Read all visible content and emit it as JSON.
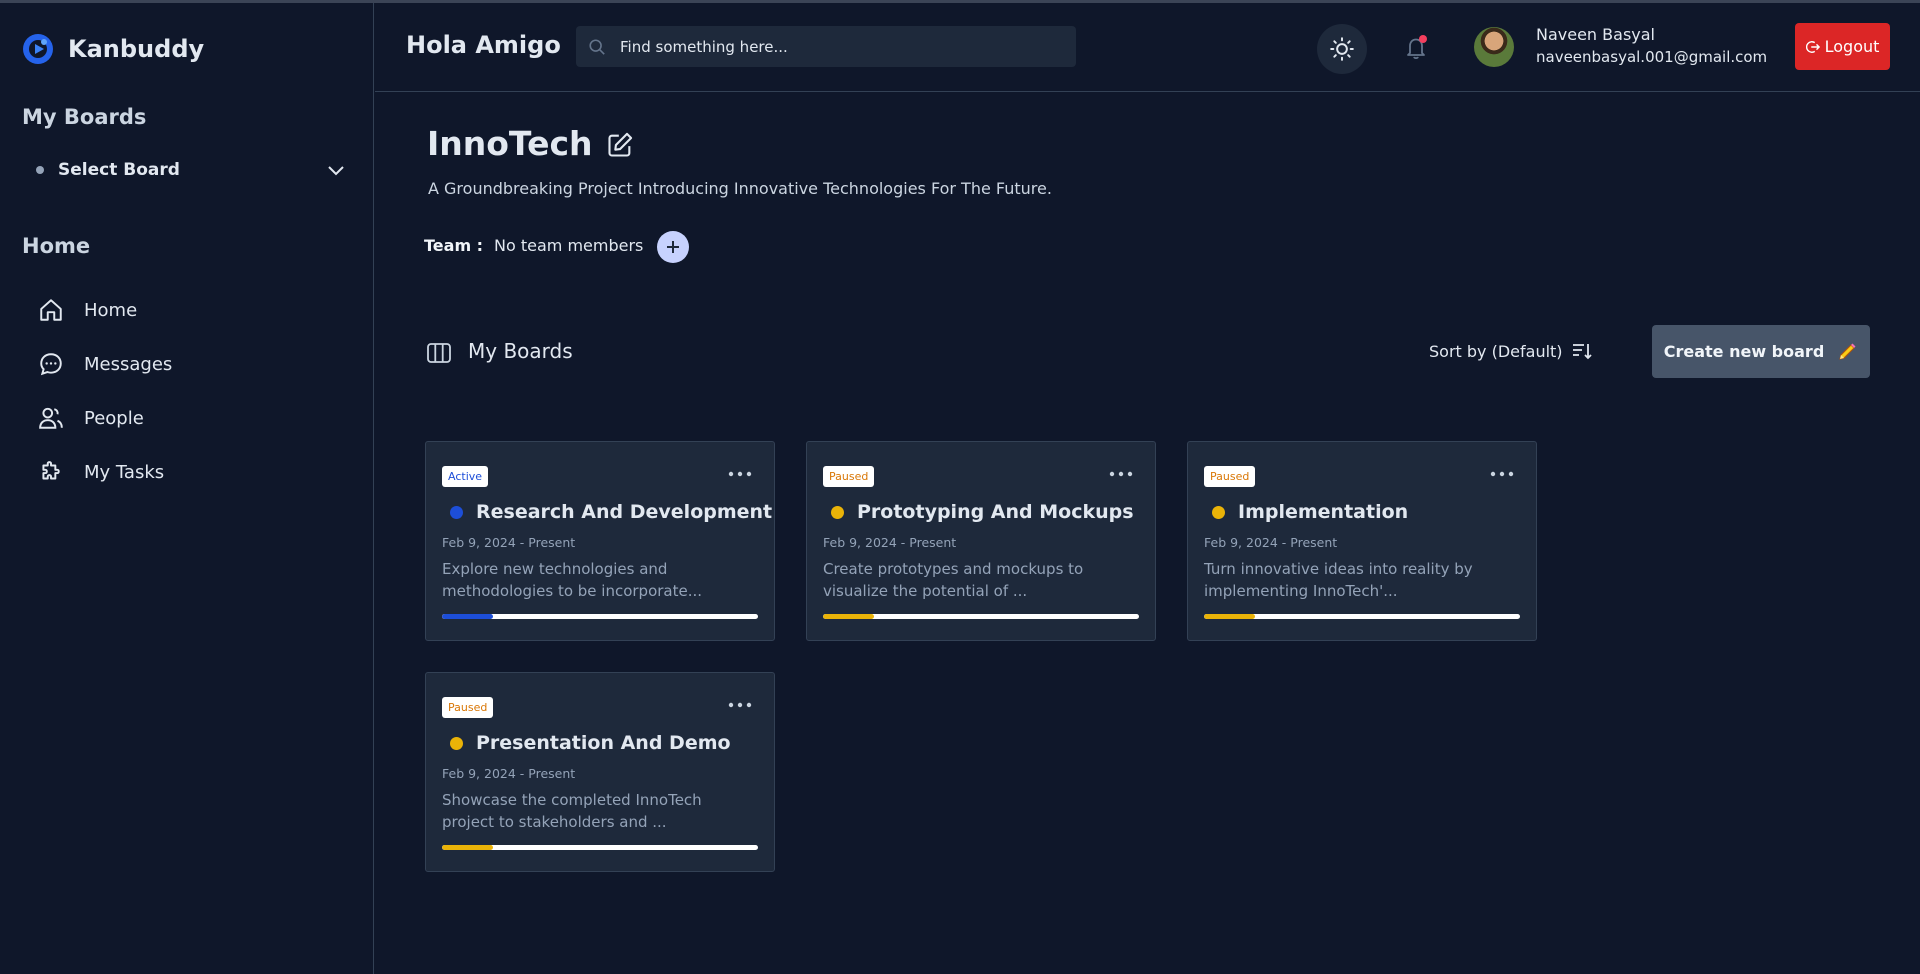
{
  "app": {
    "name": "Kanbuddy"
  },
  "sidebar": {
    "my_boards_title": "My Boards",
    "select_board_label": "Select Board",
    "home_title": "Home",
    "items": [
      {
        "label": "Home",
        "icon": "home-icon"
      },
      {
        "label": "Messages",
        "icon": "chat-icon"
      },
      {
        "label": "People",
        "icon": "people-icon"
      },
      {
        "label": "My Tasks",
        "icon": "puzzle-icon"
      }
    ]
  },
  "header": {
    "greeting": "Hola Amigo",
    "search_placeholder": "Find something here...",
    "user_name": "Naveen Basyal",
    "user_email": "naveenbasyal.001@gmail.com",
    "logout_label": "Logout"
  },
  "project": {
    "title": "InnoTech",
    "description": "A Groundbreaking Project Introducing Innovative Technologies For The Future.",
    "team_label": "Team :",
    "team_value": "No team members"
  },
  "boards_section": {
    "title": "My Boards",
    "sort_label": "Sort by (Default)",
    "create_label": "Create new board"
  },
  "colors": {
    "active": "#1d4ed8",
    "paused": "#eab308",
    "logout": "#dc2626"
  },
  "boards": [
    {
      "status": "Active",
      "title": "Research And Development",
      "date": "Feb 9, 2024 - Present",
      "description": "Explore new technologies and methodologies to be incorporate...",
      "progress": 0.16
    },
    {
      "status": "Paused",
      "title": "Prototyping And Mockups",
      "date": "Feb 9, 2024 - Present",
      "description": "Create prototypes and mockups to visualize the potential of ...",
      "progress": 0.16
    },
    {
      "status": "Paused",
      "title": "Implementation",
      "date": "Feb 9, 2024 - Present",
      "description": "Turn innovative ideas into reality by implementing InnoTech'...",
      "progress": 0.16
    },
    {
      "status": "Paused",
      "title": "Presentation And Demo",
      "date": "Feb 9, 2024 - Present",
      "description": "Showcase the completed InnoTech project to stakeholders and ...",
      "progress": 0.16
    }
  ]
}
